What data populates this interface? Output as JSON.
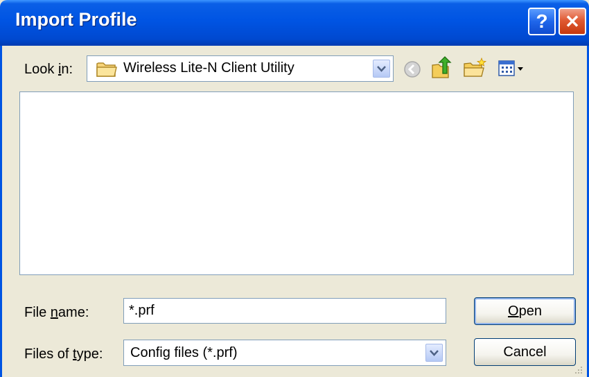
{
  "window": {
    "title": "Import Profile",
    "help_glyph": "?",
    "close_glyph": "✕"
  },
  "lookin": {
    "label_pre": "Look ",
    "label_key": "i",
    "label_post": "n:",
    "value": "Wireless Lite-N Client Utility",
    "icon": "folder-icon"
  },
  "toolbar": {
    "icons": [
      "back-icon",
      "up-folder-icon",
      "new-folder-icon",
      "view-menu-icon"
    ]
  },
  "filename": {
    "label_pre": "File ",
    "label_key": "n",
    "label_post": "ame:",
    "value": "*.prf"
  },
  "filetype": {
    "label_pre": "Files of ",
    "label_key": "t",
    "label_post": "ype:",
    "value": "Config files (*.prf)"
  },
  "buttons": {
    "open_key": "O",
    "open_rest": "pen",
    "cancel": "Cancel"
  },
  "colors": {
    "title_bar": "#0054e3",
    "dialog_bg": "#ece9d8",
    "field_border": "#7f9db9"
  }
}
